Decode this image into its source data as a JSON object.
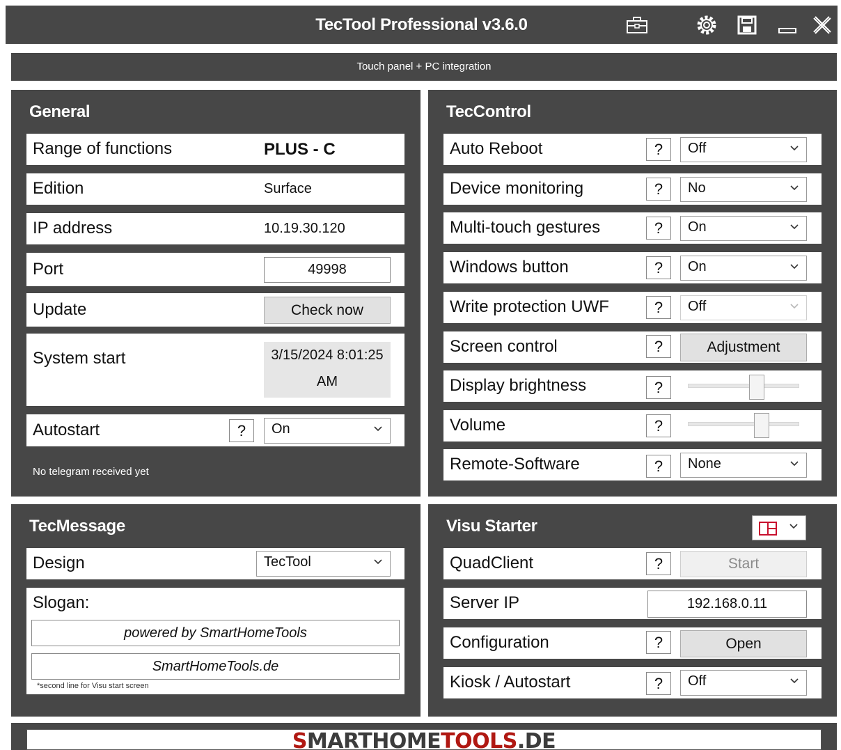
{
  "window": {
    "title": "TecTool Professional v3.6.0",
    "subtitle": "Touch panel + PC integration"
  },
  "icons": [
    "toolbox-icon",
    "gear-icon",
    "save-icon",
    "minimize-icon",
    "close-icon"
  ],
  "general": {
    "title": "General",
    "range_label": "Range of functions",
    "range_value": "PLUS - C",
    "edition_label": "Edition",
    "edition_value": "Surface",
    "ip_label": "IP address",
    "ip_value": "10.19.30.120",
    "port_label": "Port",
    "port_value": "49998",
    "update_label": "Update",
    "update_button": "Check now",
    "system_start_label": "System start",
    "system_start_line1": "3/15/2024 8:01:25",
    "system_start_line2": "AM",
    "autostart_label": "Autostart",
    "autostart_help": "?",
    "autostart_value": "On",
    "telegram_status": "No telegram received yet"
  },
  "teccontrol": {
    "title": "TecControl",
    "rows": [
      {
        "label": "Auto Reboot",
        "help": "?",
        "value": "Off"
      },
      {
        "label": "Device monitoring",
        "help": "?",
        "value": "No"
      },
      {
        "label": "Multi-touch gestures",
        "help": "?",
        "value": "On"
      },
      {
        "label": "Windows button",
        "help": "?",
        "value": "On"
      },
      {
        "label": "Write protection UWF",
        "help": "?",
        "value": "Off"
      },
      {
        "label": "Screen control",
        "help": "?",
        "button": "Adjustment"
      },
      {
        "label": "Display brightness",
        "help": "?",
        "level": 0.62
      },
      {
        "label": "Volume",
        "help": "?",
        "level": 0.66
      },
      {
        "label": "Remote-Software",
        "help": "?",
        "value": "None"
      }
    ]
  },
  "tecmessage": {
    "title": "TecMessage",
    "design_label": "Design",
    "design_value": "TecTool",
    "slogan_label": "Slogan:",
    "slogan_line1": "powered by SmartHomeTools",
    "slogan_line2": "SmartHomeTools.de",
    "slogan_note": "*second line for Visu start screen"
  },
  "visu": {
    "title": "Visu Starter",
    "layout_icon": "layout-grid-icon",
    "quadclient_label": "QuadClient",
    "quadclient_help": "?",
    "quadclient_button": "Start",
    "server_ip_label": "Server IP",
    "server_ip_value": "192.168.0.11",
    "config_label": "Configuration",
    "config_help": "?",
    "config_button": "Open",
    "kiosk_label": "Kiosk / Autostart",
    "kiosk_help": "?",
    "kiosk_value": "Off"
  },
  "footer": {
    "logo_part1": "S",
    "logo_part2": "MARTHOME",
    "logo_part3": "TOOLS",
    "logo_part4": ".DE"
  },
  "colors": {
    "panel": "#474747",
    "accent": "#b01812"
  }
}
